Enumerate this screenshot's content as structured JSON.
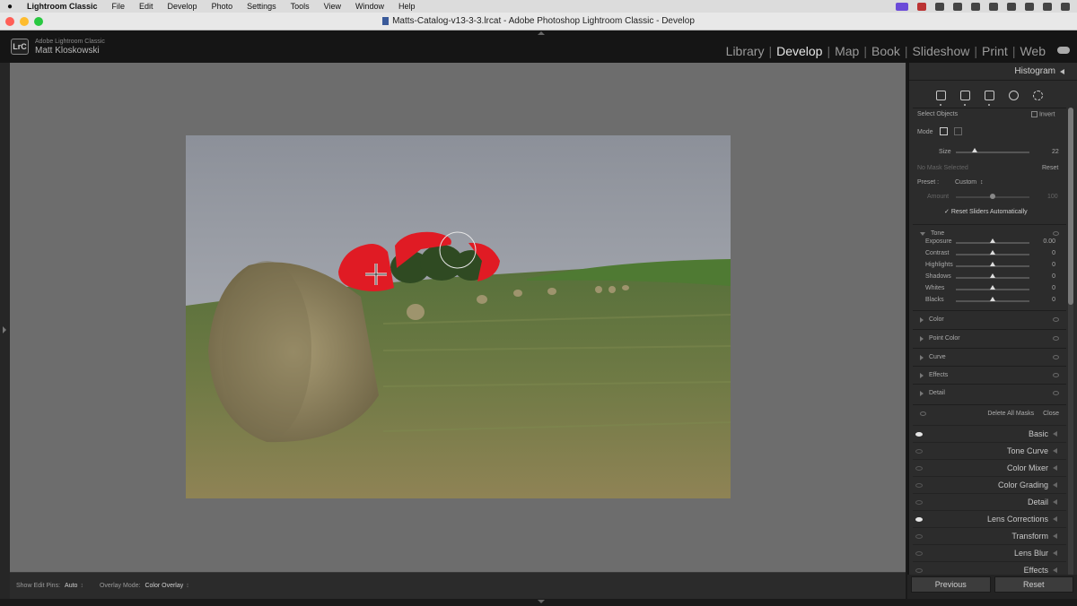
{
  "macbar": {
    "app": "Lightroom Classic",
    "menus": [
      "File",
      "Edit",
      "Develop",
      "Photo",
      "Settings",
      "Tools",
      "View",
      "Window",
      "Help"
    ]
  },
  "window": {
    "title": "Matts-Catalog-v13-3-3.lrcat - Adobe Photoshop Lightroom Classic - Develop"
  },
  "identity": {
    "line1": "Adobe Lightroom Classic",
    "line2": "Matt Kloskowski",
    "logo": "LrC"
  },
  "modules": [
    "Library",
    "Develop",
    "Map",
    "Book",
    "Slideshow",
    "Print",
    "Web"
  ],
  "active_module": "Develop",
  "right_panel": {
    "histogram": "Histogram",
    "mask": {
      "title": "Select Objects",
      "invert": "Invert",
      "mode_label": "Mode",
      "size_label": "Size",
      "size_value": "22",
      "size_level": 0.25,
      "no_mask": "No Mask Selected",
      "reset": "Reset",
      "preset_label": "Preset :",
      "preset_value": "Custom",
      "amount_label": "Amount",
      "amount_value": "100",
      "reset_sliders": "Reset Sliders Automatically"
    },
    "tone": {
      "title": "Tone",
      "sliders": [
        {
          "label": "Exposure",
          "value": "0.00"
        },
        {
          "label": "Contrast",
          "value": "0"
        },
        {
          "label": "Highlights",
          "value": "0"
        },
        {
          "label": "Shadows",
          "value": "0"
        },
        {
          "label": "Whites",
          "value": "0"
        },
        {
          "label": "Blacks",
          "value": "0"
        }
      ]
    },
    "sections": [
      "Color",
      "Point Color",
      "Curve",
      "Effects",
      "Detail"
    ],
    "delete_all_masks": "Delete All Masks",
    "close": "Close",
    "panels": [
      {
        "label": "Basic",
        "eye": true
      },
      {
        "label": "Tone Curve",
        "eye": false
      },
      {
        "label": "Color Mixer",
        "eye": false
      },
      {
        "label": "Color Grading",
        "eye": false
      },
      {
        "label": "Detail",
        "eye": false
      },
      {
        "label": "Lens Corrections",
        "eye": true
      },
      {
        "label": "Transform",
        "eye": false
      },
      {
        "label": "Lens Blur",
        "eye": false
      },
      {
        "label": "Effects",
        "eye": false
      }
    ],
    "previous": "Previous",
    "reset_button": "Reset"
  },
  "toolbar": {
    "edit_pins_label": "Show Edit Pins:",
    "edit_pins_value": "Auto",
    "overlay_label": "Overlay Mode:",
    "overlay_value": "Color Overlay"
  },
  "colors": {
    "overlay_red": "#e01b24",
    "panel_bg": "#2c2c2c",
    "canvas_bg": "#6d6d6d"
  }
}
